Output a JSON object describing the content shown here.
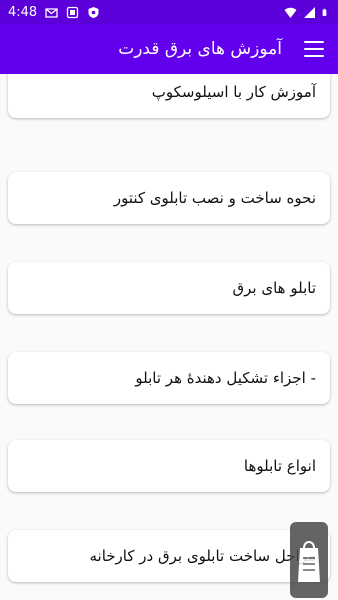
{
  "status_bar": {
    "time": "4:48",
    "icons": [
      "gmail-icon",
      "box-icon",
      "shield-icon",
      "wifi-icon",
      "signal-icon",
      "battery-icon"
    ]
  },
  "app_bar": {
    "title": "آموزش های برق قدرت",
    "menu_icon": "hamburger-menu-icon",
    "color": "#6200ee"
  },
  "items": [
    "آموزش کار با اسیلوسکوپ",
    "نحوه ساخت و نصب تابلوی کنتور",
    "تابلو های برق",
    "- اجزاء تشکیل دهندهٔ هر تابلو",
    "انواع تابلوها",
    "مراحل ساخت تابلوی برق در کارخانه"
  ],
  "colors": {
    "status_bar": "#5b00d8",
    "app_bar": "#6200ee",
    "background": "#fafafa",
    "card": "#ffffff"
  }
}
